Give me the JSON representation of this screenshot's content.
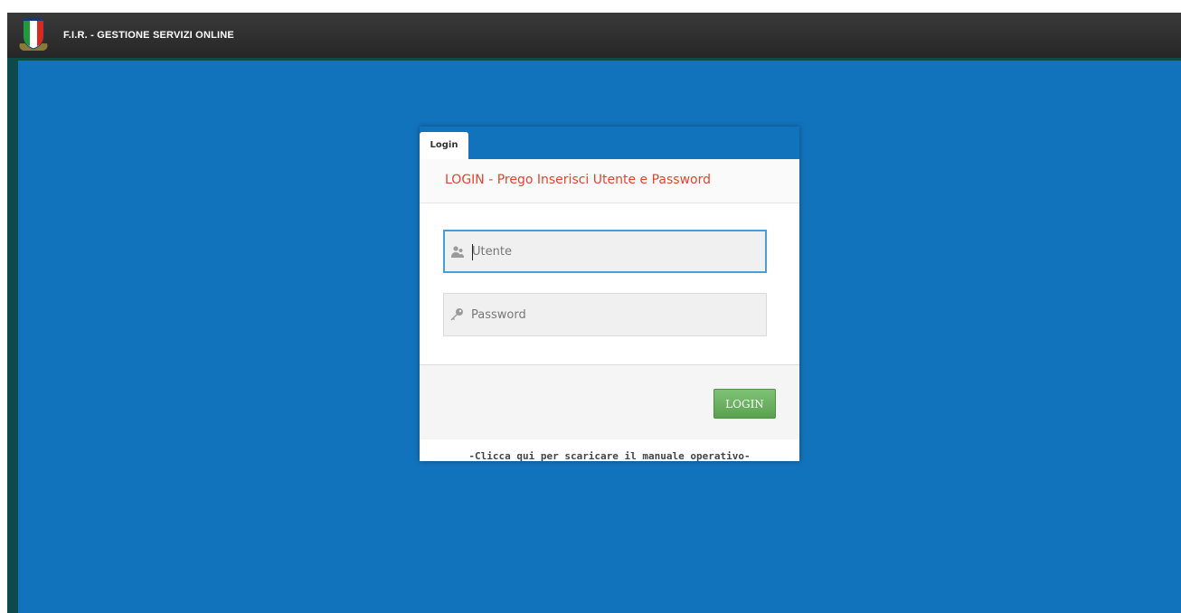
{
  "header": {
    "title": "F.I.R. - GESTIONE SERVIZI ONLINE",
    "logo_icon": "fir-shield-logo-icon"
  },
  "login": {
    "tab_label": "Login",
    "heading": "LOGIN - Prego Inserisci Utente e Password",
    "user_field": {
      "icon": "user-icon",
      "value": "",
      "placeholder": "Utente"
    },
    "password_field": {
      "icon": "key-icon",
      "value": "",
      "placeholder": "Password"
    },
    "submit_label": "LOGIN",
    "manual_link": "-Clicca qui per scaricare il manuale operativo-"
  },
  "colors": {
    "background_blue": "#1273bd",
    "heading_red": "#e2452e",
    "button_green": "#5aa24f",
    "topbar_dark": "#2e2e2e"
  }
}
